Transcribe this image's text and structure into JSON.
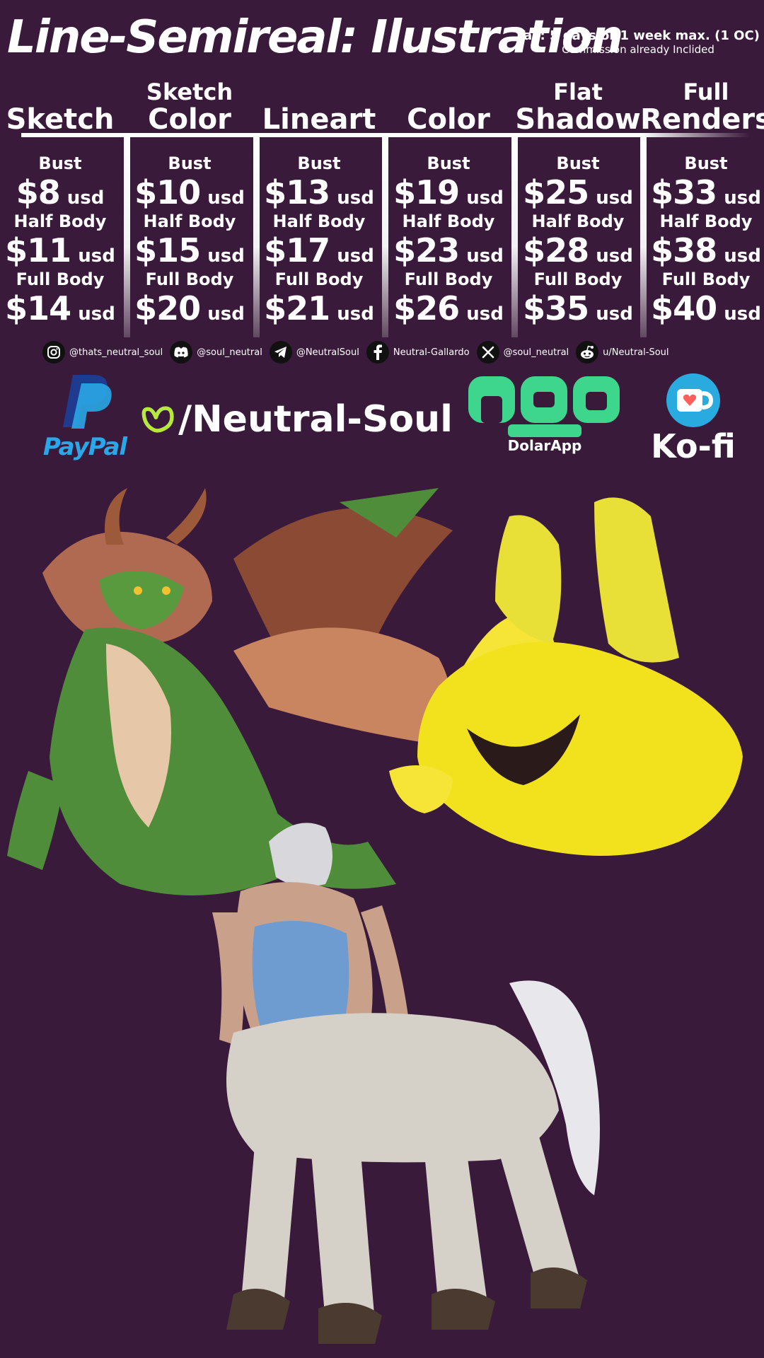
{
  "title": "Line-Semireal: Ilustration",
  "tat": {
    "main": "TaT: 5 days or 1 week max. (1 OC)",
    "sub": "Commission already Inclided"
  },
  "columns": [
    {
      "head_l1": "",
      "head_l2": "Sketch",
      "bust": "$8",
      "half": "$11",
      "full": "$14"
    },
    {
      "head_l1": "Sketch",
      "head_l2": "Color",
      "bust": "$10",
      "half": "$15",
      "full": "$20"
    },
    {
      "head_l1": "",
      "head_l2": "Lineart",
      "bust": "$13",
      "half": "$17",
      "full": "$21"
    },
    {
      "head_l1": "",
      "head_l2": "Color",
      "bust": "$19",
      "half": "$23",
      "full": "$26"
    },
    {
      "head_l1": "Flat",
      "head_l2": "Shadow",
      "bust": "$25",
      "half": "$28",
      "full": "$35"
    },
    {
      "head_l1": "Full",
      "head_l2": "Renders",
      "bust": "$33",
      "half": "$38",
      "full": "$40"
    }
  ],
  "sizes": {
    "bust": "Bust",
    "half": "Half Body",
    "full": "Full Body"
  },
  "currency": "usd",
  "social": [
    {
      "icon": "instagram-icon",
      "text": "@thats_neutral_soul"
    },
    {
      "icon": "discord-icon",
      "text": "@soul_neutral"
    },
    {
      "icon": "telegram-icon",
      "text": "@NeutralSoul"
    },
    {
      "icon": "facebook-icon",
      "text": "Neutral-Gallardo"
    },
    {
      "icon": "x-icon",
      "text": "@soul_neutral"
    },
    {
      "icon": "reddit-icon",
      "text": "u/Neutral-Soul"
    }
  ],
  "payments": {
    "paypal": "PayPal",
    "vgen": "/Neutral-Soul",
    "dolarapp": "DolarApp",
    "kofi": "Ko-fi"
  },
  "colors": {
    "background": "#3a1a3a",
    "text": "#ffffff",
    "paypal_dark": "#1f3b8f",
    "paypal_light": "#2aa7e6",
    "vgen_green": "#b6e93a",
    "dolarapp_green": "#3dd68c",
    "kofi_blue": "#29abe0",
    "kofi_heart": "#ff5e5b"
  }
}
